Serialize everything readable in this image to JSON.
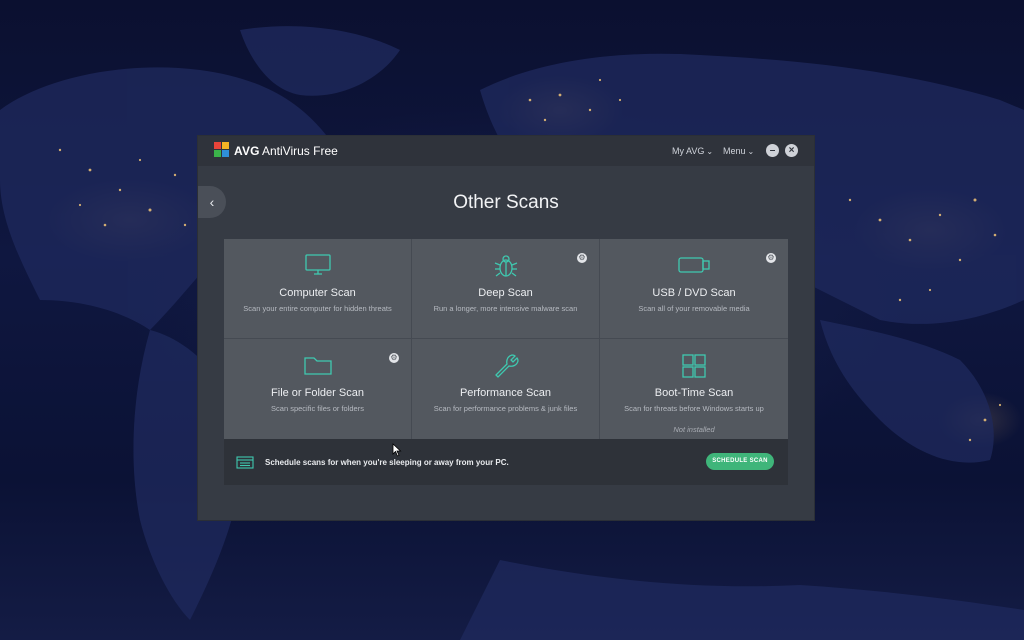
{
  "app": {
    "brand": "AVG",
    "product": "AntiVirus Free",
    "menu_my_avg": "My AVG",
    "menu_menu": "Menu"
  },
  "page": {
    "title": "Other Scans"
  },
  "tiles": [
    {
      "name": "Computer Scan",
      "desc": "Scan your entire computer for hidden threats",
      "icon": "monitor-icon",
      "settings": false,
      "note": ""
    },
    {
      "name": "Deep Scan",
      "desc": "Run a longer, more intensive malware scan",
      "icon": "bug-icon",
      "settings": true,
      "note": ""
    },
    {
      "name": "USB / DVD Scan",
      "desc": "Scan all of your removable media",
      "icon": "usb-drive-icon",
      "settings": true,
      "note": ""
    },
    {
      "name": "File or Folder Scan",
      "desc": "Scan specific files or folders",
      "icon": "folder-icon",
      "settings": true,
      "note": ""
    },
    {
      "name": "Performance Scan",
      "desc": "Scan for performance problems & junk files",
      "icon": "wrench-icon",
      "settings": false,
      "note": ""
    },
    {
      "name": "Boot-Time Scan",
      "desc": "Scan for threats before Windows starts up",
      "icon": "windows-icon",
      "settings": false,
      "note": "Not installed"
    }
  ],
  "schedule": {
    "text": "Schedule scans for when you're sleeping or away from your PC.",
    "button": "SCHEDULE SCAN"
  },
  "colors": {
    "accent": "#3fb57a",
    "tile": "#53585f",
    "window": "#363b44"
  }
}
